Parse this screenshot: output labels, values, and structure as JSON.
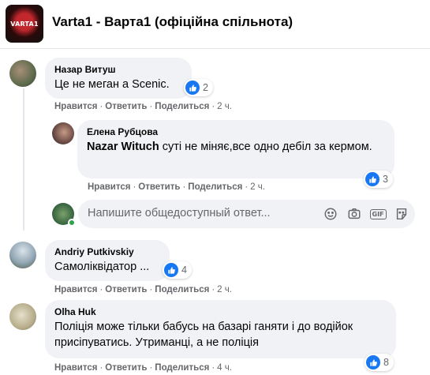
{
  "header": {
    "logo_text": "VARTA1",
    "title": "Varta1 - Варта1 (офіційна спільнота)"
  },
  "actions": {
    "like": "Нравится",
    "reply": "Ответить",
    "share": "Поделиться",
    "dot": "·"
  },
  "comments": [
    {
      "name": "Назар Витуш",
      "text": "Це не меган а Scenic.",
      "likes": "2",
      "time": "2 ч."
    },
    {
      "name": "Елена Рубцова",
      "mention": "Nazar Wituch",
      "text": " суті не міняє,все одно дебіл за кермом.",
      "likes": "3",
      "time": "2 ч."
    },
    {
      "name": "Andriy Putkivskiy",
      "text": "Самоліквідатор ...",
      "likes": "4",
      "time": "2 ч."
    },
    {
      "name": "Olha Huk",
      "text": "Поліція може тільки бабусь на базарі ганяти і до водійок присіпуватись. Утриманці, а не поліція",
      "likes": "8",
      "time": "4 ч."
    }
  ],
  "reply_box": {
    "placeholder": "Напишите общедоступный ответ...",
    "icons": [
      "smile-icon",
      "camera-icon",
      "gif-icon",
      "sticker-icon"
    ]
  },
  "colors": {
    "like_blue": "#1877f2",
    "bubble_bg": "#f0f2f5",
    "meta_gray": "#65676b",
    "online_green": "#31a24c"
  }
}
